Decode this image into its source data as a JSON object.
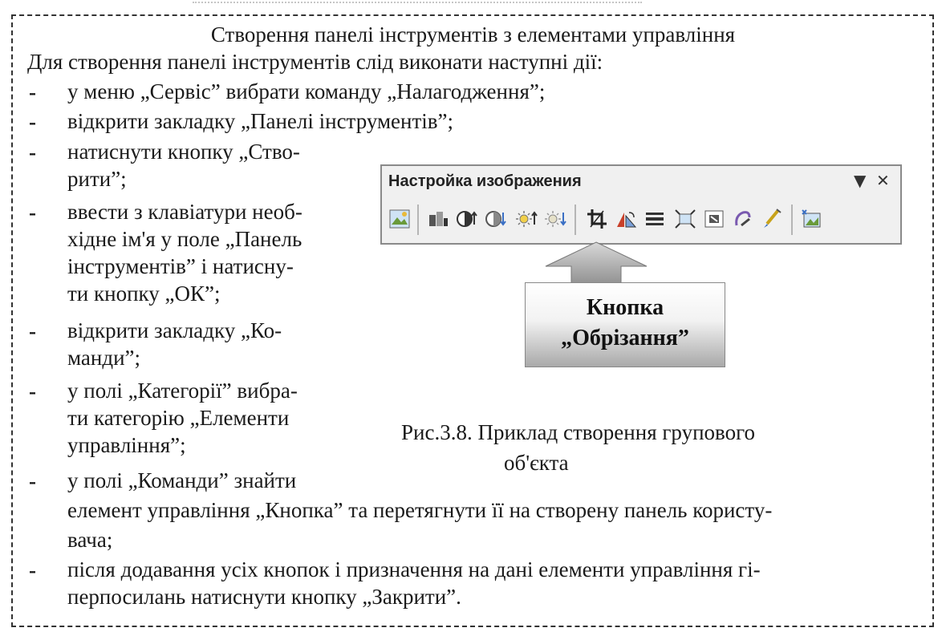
{
  "doc": {
    "title": "Створення панелі інструментів з елементами управління",
    "intro": "Для створення панелі інструментів слід виконати наступні дії:",
    "items": [
      "у меню „Сервіс” вибрати команду „Налагодження”;",
      "відкрити закладку „Панелі інструментів”;",
      "натиснути кнопку „Створити”;",
      "ввести з клавіатури необхідне ім'я у поле „Панель інструментів” і натиснути кнопку „ОК”;",
      "відкрити закладку „Команди”;",
      "у полі „Категорії” вибрати категорію „Елементи управління”;",
      "у полі „Команди” знайти елемент управління „Кнопка” та перетягнути її  на створену панель користувача;",
      "після додавання усіх кнопок і призначення на дані елементи управління гіперпосилань натиснути кнопку „Закрити”."
    ],
    "lines": {
      "i3a": "натиснути кнопку „Ство-",
      "i3b": "рити”;",
      "i4a": "ввести з клавіатури необ-",
      "i4b": "хідне ім'я у поле „Панель",
      "i4c": "інструментів” і натисну-",
      "i4d": "ти кнопку „ОК”;",
      "i5a": "відкрити закладку „Ко-",
      "i5b": "манди”;",
      "i6a": "у полі „Категорії” вибра-",
      "i6b": "ти категорію „Елементи",
      "i6c": "управління”;",
      "i7a": "у полі „Команди” знайти",
      "i7b": "елемент управління „Кнопка” та перетягнути її  на створену панель користу-",
      "i7c": "вача;",
      "i8a": "після додавання усіх кнопок і призначення на дані елементи управління гі-",
      "i8b": "перпосилань натиснути кнопку „Закрити”."
    }
  },
  "toolbar": {
    "title": "Настройка изображения",
    "dropdown_glyph": "▼",
    "close_glyph": "✕",
    "icons": [
      "insert-picture-icon",
      "color-icon",
      "more-contrast-icon",
      "less-contrast-icon",
      "more-brightness-icon",
      "less-brightness-icon",
      "crop-icon",
      "rotate-left-icon",
      "line-style-icon",
      "compress-pictures-icon",
      "text-wrapping-icon",
      "format-picture-icon",
      "set-transparent-color-icon",
      "reset-picture-icon"
    ]
  },
  "callout": {
    "line1": "Кнопка",
    "line2": "„Обрізання”"
  },
  "caption": {
    "line1": "Рис.3.8. Приклад створення групового",
    "line2": "об'єкта"
  }
}
